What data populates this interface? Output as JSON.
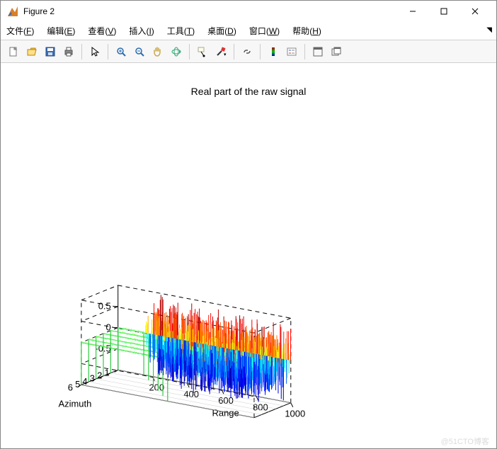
{
  "window": {
    "title": "Figure 2"
  },
  "menu": {
    "file": {
      "label": "文件",
      "accel": "F"
    },
    "edit": {
      "label": "编辑",
      "accel": "E"
    },
    "view": {
      "label": "查看",
      "accel": "V"
    },
    "insert": {
      "label": "插入",
      "accel": "I"
    },
    "tools": {
      "label": "工具",
      "accel": "T"
    },
    "desktop": {
      "label": "桌面",
      "accel": "D"
    },
    "window": {
      "label": "窗口",
      "accel": "W"
    },
    "help": {
      "label": "帮助",
      "accel": "H"
    }
  },
  "toolbar": {
    "new": "新建",
    "open": "打开",
    "save": "保存",
    "print": "打印",
    "pointer": "指针",
    "zoomin": "放大",
    "zoomout": "缩小",
    "pan": "平移",
    "rotate": "旋转3D",
    "datacursor": "数据游标",
    "brush": "刷选",
    "link": "链接",
    "colorbar": "颜色条",
    "legend": "图例",
    "dock": "停靠",
    "undock": "解除停靠"
  },
  "chart": {
    "title": "Real part of the raw signal",
    "xlabel": "Range",
    "ylabel": "Azimuth"
  },
  "watermark": "@51CTO博客",
  "chart_data": {
    "type": "3d-waterfall",
    "title": "Real part of the raw signal",
    "x_axis": {
      "label": "Range",
      "ticks": [
        200,
        400,
        600,
        800,
        1000
      ],
      "lim": [
        1,
        1000
      ]
    },
    "y_axis": {
      "label": "Azimuth",
      "ticks": [
        1,
        2,
        3,
        4,
        5,
        6
      ],
      "lim": [
        1,
        6
      ]
    },
    "z_axis": {
      "label": "",
      "ticks": [
        -0.5,
        0,
        0.5
      ],
      "lim": [
        -1,
        1
      ]
    },
    "colormap": "jet",
    "description": "Waterfall/plot3 style display. For each Azimuth index 1..6 a dense oscillatory trace is plotted along Range 1..1000. Amplitude envelope is near 0 for low Range then rises to roughly ±0.7..1.0 and stays high through Range≈1000; the onset of the high-amplitude region shifts to larger Range as Azimuth increases (onset ≈150 at Azimuth 1, ≈500 at Azimuth 6). Trace color follows signal value via the jet colormap (blue ≈ -1, cyan/green ≈ 0, yellow/red ≈ +1).",
    "series": [
      {
        "azimuth": 1,
        "high_amp_onset_range": 150,
        "peak_amplitude": 1.0
      },
      {
        "azimuth": 2,
        "high_amp_onset_range": 220,
        "peak_amplitude": 0.95
      },
      {
        "azimuth": 3,
        "high_amp_onset_range": 290,
        "peak_amplitude": 0.9
      },
      {
        "azimuth": 4,
        "high_amp_onset_range": 360,
        "peak_amplitude": 0.85
      },
      {
        "azimuth": 5,
        "high_amp_onset_range": 430,
        "peak_amplitude": 0.8
      },
      {
        "azimuth": 6,
        "high_amp_onset_range": 500,
        "peak_amplitude": 0.75
      }
    ]
  }
}
